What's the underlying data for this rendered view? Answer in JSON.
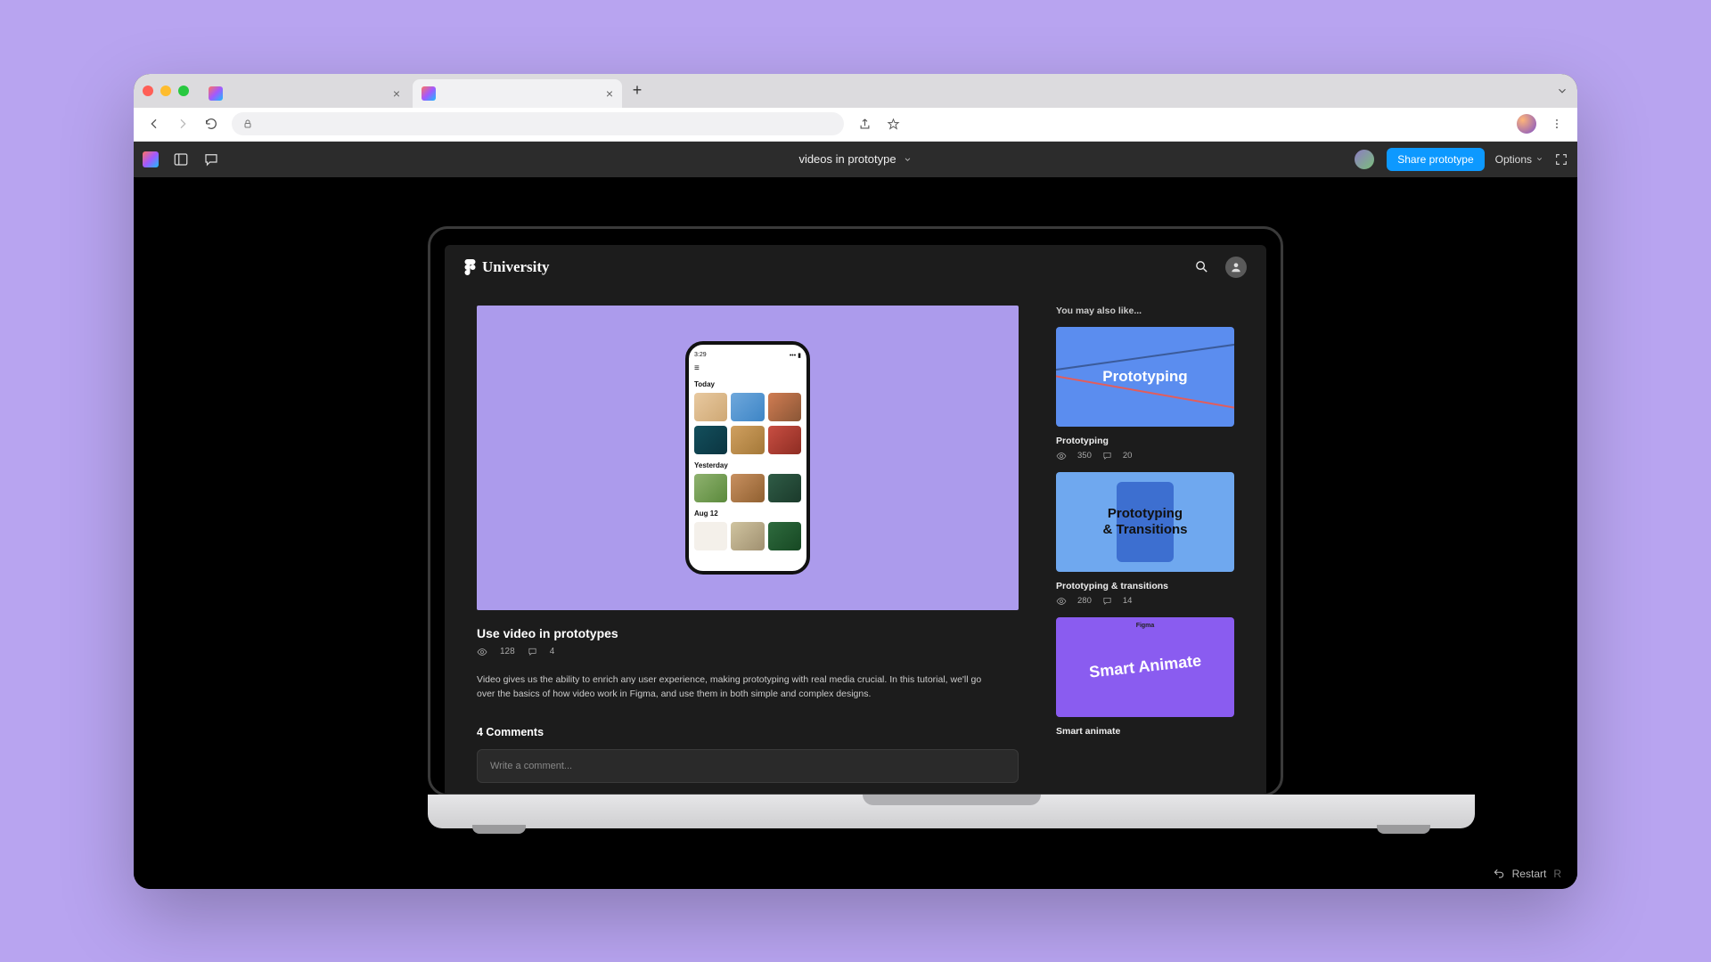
{
  "browser": {
    "tabs": [
      {
        "title": "",
        "active": false
      },
      {
        "title": "",
        "active": true
      }
    ],
    "new_tab": "+"
  },
  "figma_bar": {
    "doc_title": "videos in prototype",
    "share_label": "Share prototype",
    "options_label": "Options"
  },
  "restart": {
    "label": "Restart",
    "key": "R"
  },
  "university": {
    "brand": "University",
    "video": {
      "title": "Use video in prototypes",
      "views": "128",
      "comments": "4",
      "description": "Video gives us the ability to enrich any user experience, making prototyping with real media crucial. In this tutorial, we'll go over the basics of how video work in Figma, and use them in both simple and complex designs.",
      "phone": {
        "time": "3:29",
        "section1": "Today",
        "section2": "Yesterday",
        "section3": "Aug 12"
      }
    },
    "comments_heading": "4 Comments",
    "comment_placeholder": "Write a comment...",
    "sidebar": {
      "heading": "You may also like...",
      "cards": [
        {
          "thumb_text": "Prototyping",
          "title": "Prototyping",
          "views": "350",
          "comments": "20"
        },
        {
          "thumb_text": "Prototyping\n& Transitions",
          "title": "Prototyping & transitions",
          "views": "280",
          "comments": "14"
        },
        {
          "thumb_text": "Smart Animate",
          "title": "Smart animate",
          "views": "",
          "comments": ""
        }
      ]
    }
  }
}
